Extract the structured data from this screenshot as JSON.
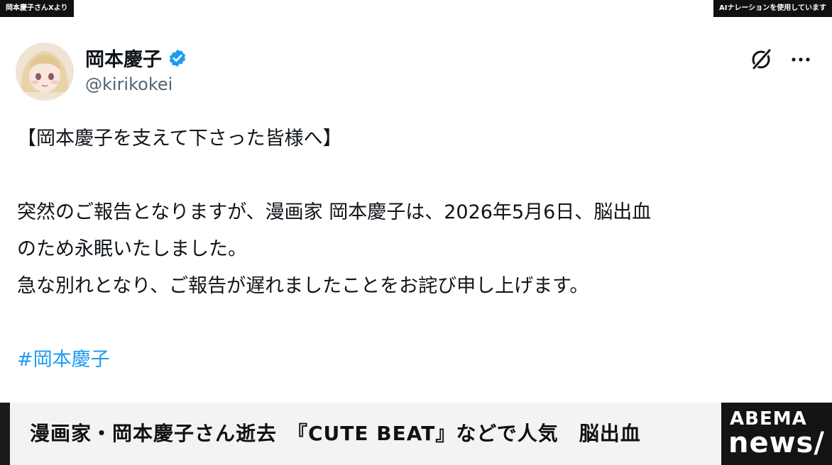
{
  "overlay": {
    "source_tag": "岡本慶子さんXより",
    "ai_notice": "AIナレーションを使用しています"
  },
  "post": {
    "display_name": "岡本慶子",
    "handle": "@kirikokei",
    "verified": true,
    "avatar_icon": "avatar-illustration",
    "menu_icons": [
      "grok-icon",
      "more-icon"
    ],
    "lines": [
      "【岡本慶子を支えて下さった皆様へ】",
      "突然のご報告となりますが、漫画家 岡本慶子は、2026年5月6日、脳出血",
      "のため永眠いたしました。",
      "急な別れとなり、ご報告が遅れましたことをお詫び申し上げます。"
    ],
    "hashtag": "#岡本慶子"
  },
  "banner": {
    "headline": "漫画家・岡本慶子さん逝去　『CUTE BEAT』などで人気　脳出血",
    "logo_top": "ABEMA",
    "logo_bottom": "news/"
  },
  "colors": {
    "link": "#1d9bf0",
    "verified": "#1d9bf0",
    "text": "#0f1419",
    "handle": "#536471",
    "logo_bg": "#141414"
  }
}
